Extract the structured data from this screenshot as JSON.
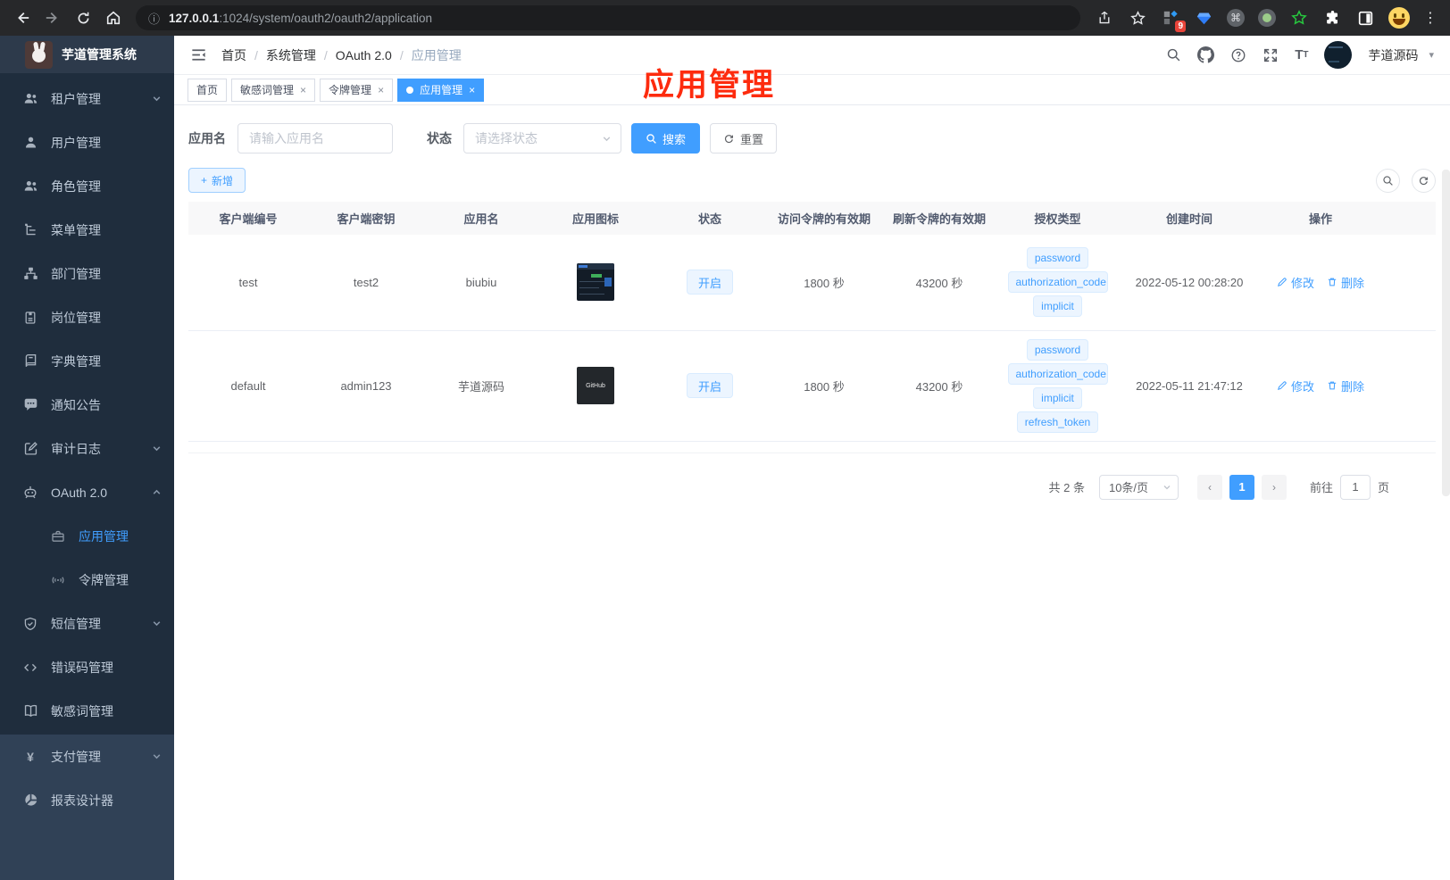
{
  "colors": {
    "accent": "#409eff",
    "sidebar_dark": "#1f2d3d",
    "sidebar_light": "#304156",
    "annotation_red": "#fd2b0e",
    "tag_bg": "#ecf5ff"
  },
  "icons": {
    "plus": "+",
    "close": "×",
    "caret_down": "▾",
    "kebab": "⋮",
    "info": "ⓘ",
    "yen": "¥",
    "letter_T": "T",
    "question": "?",
    "command": "⌘",
    "prev": "‹",
    "next": "›"
  },
  "browser": {
    "url_host": "127.0.0.1",
    "url_path": ":1024/system/oauth2/oauth2/application",
    "extension_badge": "9"
  },
  "sidebar": {
    "title": "芋道管理系统",
    "items": [
      {
        "label": "租户管理"
      },
      {
        "label": "用户管理"
      },
      {
        "label": "角色管理"
      },
      {
        "label": "菜单管理"
      },
      {
        "label": "部门管理"
      },
      {
        "label": "岗位管理"
      },
      {
        "label": "字典管理"
      },
      {
        "label": "通知公告"
      },
      {
        "label": "审计日志"
      },
      {
        "label": "OAuth 2.0"
      },
      {
        "label": "应用管理"
      },
      {
        "label": "令牌管理"
      },
      {
        "label": "短信管理"
      },
      {
        "label": "错误码管理"
      },
      {
        "label": "敏感词管理"
      },
      {
        "label": "支付管理"
      },
      {
        "label": "报表设计器"
      }
    ]
  },
  "header": {
    "breadcrumb": [
      "首页",
      "系统管理",
      "OAuth 2.0",
      "应用管理"
    ],
    "separator": "/",
    "username": "芋道源码"
  },
  "tabs": [
    {
      "label": "首页"
    },
    {
      "label": "敏感词管理"
    },
    {
      "label": "令牌管理"
    },
    {
      "label": "应用管理"
    }
  ],
  "annotation": {
    "text": "应用管理"
  },
  "filters": {
    "name_label": "应用名",
    "name_placeholder": "请输入应用名",
    "status_label": "状态",
    "status_placeholder": "请选择状态",
    "search_label": "搜索",
    "reset_label": "重置"
  },
  "toolbar": {
    "add_label": "新增"
  },
  "table": {
    "columns": [
      "客户端编号",
      "客户端密钥",
      "应用名",
      "应用图标",
      "状态",
      "访问令牌的有效期",
      "刷新令牌的有效期",
      "授权类型",
      "创建时间",
      "操作"
    ],
    "edit_label": "修改",
    "delete_label": "删除",
    "rows": [
      {
        "client_id": "test",
        "secret": "test2",
        "name": "biubiu",
        "status": "开启",
        "access_ttl": "1800 秒",
        "refresh_ttl": "43200 秒",
        "grants": [
          "password",
          "authorization_code",
          "implicit"
        ],
        "created": "2022-05-12 00:28:20"
      },
      {
        "client_id": "default",
        "secret": "admin123",
        "name": "芋道源码",
        "status": "开启",
        "access_ttl": "1800 秒",
        "refresh_ttl": "43200 秒",
        "grants": [
          "password",
          "authorization_code",
          "implicit",
          "refresh_token"
        ],
        "created": "2022-05-11 21:47:12"
      }
    ]
  },
  "pagination": {
    "total": "共 2 条",
    "page_size": "10条/页",
    "current_page": "1",
    "goto_label": "前往",
    "goto_value": "1",
    "page_unit": "页"
  }
}
